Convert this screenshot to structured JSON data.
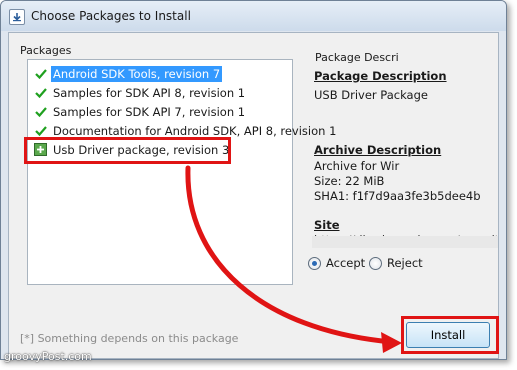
{
  "window": {
    "title": "Choose Packages to Install",
    "icon": "download-package-icon"
  },
  "packages_group": {
    "label": "Packages",
    "items": [
      {
        "label": "Android SDK Tools, revision 7",
        "status": "accepted",
        "selected": true
      },
      {
        "label": "Samples for SDK API 8, revision 1",
        "status": "accepted",
        "selected": false
      },
      {
        "label": "Samples for SDK API 7, revision 1",
        "status": "accepted",
        "selected": false
      },
      {
        "label": "Documentation for Android SDK, API 8, revision 1",
        "status": "accepted",
        "selected": false
      },
      {
        "label": "Usb Driver package, revision 3",
        "status": "new",
        "selected": false
      }
    ]
  },
  "description_group": {
    "label": "Package Descri",
    "package_description_heading": "Package Description",
    "package_description_text": "USB Driver Package",
    "archive_description_heading": "Archive Description",
    "archive_for": "Archive for Wir",
    "size": "Size: 22 MiB",
    "sha1": "SHA1: f1f7d9aa3fe3b5dee4b",
    "site_heading": "Site",
    "site_url": "https://dl-ssl.google.com/repository.xml"
  },
  "choice": {
    "accept_label": "Accept",
    "reject_label": "Reject",
    "selected": "accept"
  },
  "footer": {
    "dependency_note": "[*] Something depends on this package",
    "install_label": "Install"
  },
  "annotations": {
    "highlight_color": "#e01414"
  },
  "watermark": "groovyPost.com"
}
